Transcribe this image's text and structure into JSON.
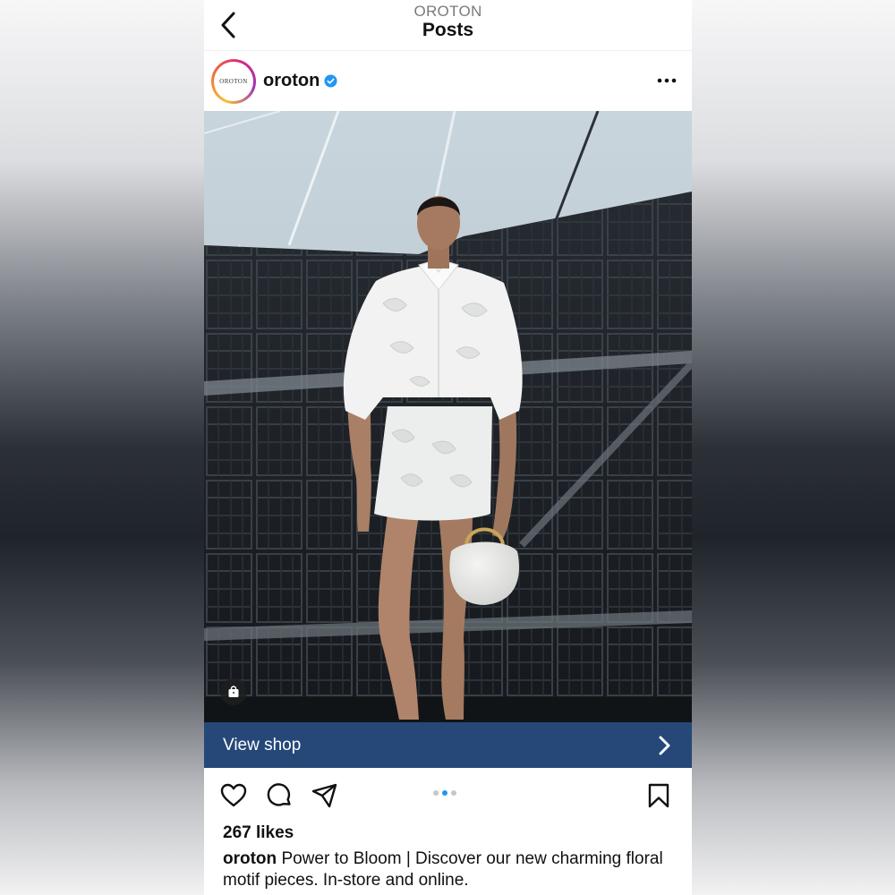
{
  "nav": {
    "account": "OROTON",
    "title": "Posts"
  },
  "post": {
    "avatar_text": "OROTON",
    "username": "oroton",
    "verified": true,
    "shop_cta": "View shop",
    "likes": "267 likes",
    "caption_user": "oroton",
    "caption_text": "Power to Bloom | Discover our new charming floral motif pieces. In-store and online.",
    "carousel": {
      "count": 3,
      "active_index": 1
    }
  },
  "icons": {
    "back": "chevron-left-icon",
    "verified": "verified-badge-icon",
    "more": "more-horizontal-icon",
    "shop_tag": "shopping-bag-icon",
    "shop_chevron": "chevron-right-icon",
    "like": "heart-icon",
    "comment": "comment-icon",
    "share": "send-icon",
    "save": "bookmark-icon"
  },
  "colors": {
    "shop_bar": "#254879",
    "carousel_active": "#2196f3",
    "verified": "#2196f3"
  }
}
